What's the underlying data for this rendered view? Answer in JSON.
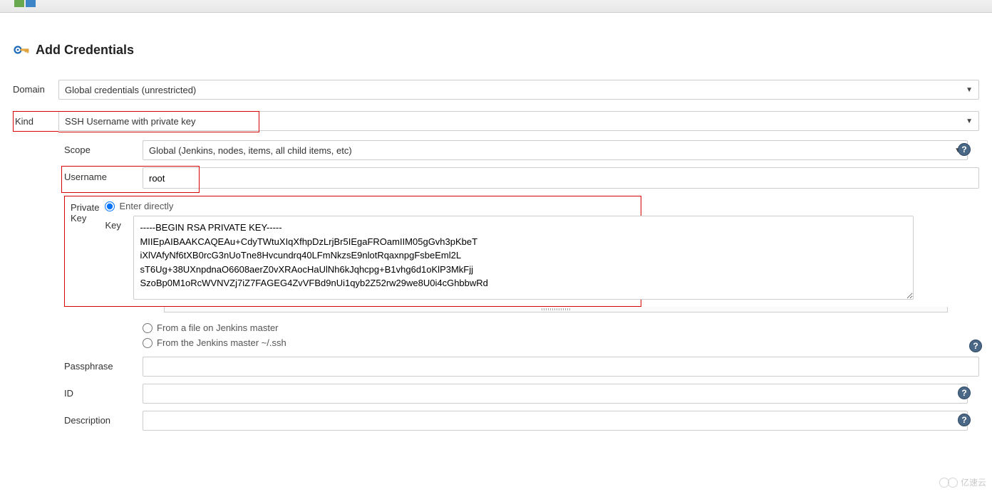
{
  "page": {
    "title": "Add Credentials"
  },
  "domain": {
    "label": "Domain",
    "value": "Global credentials (unrestricted)"
  },
  "kind": {
    "label": "Kind",
    "value": "SSH Username with private key"
  },
  "scope": {
    "label": "Scope",
    "value": "Global (Jenkins, nodes, items, all child items, etc)"
  },
  "username": {
    "label": "Username",
    "value": "root"
  },
  "private_key": {
    "label": "Private Key",
    "radio_enter_directly": "Enter directly",
    "radio_from_file": "From a file on Jenkins master",
    "radio_from_ssh": "From the Jenkins master ~/.ssh",
    "key_label": "Key",
    "key_value": "-----BEGIN RSA PRIVATE KEY-----\nMIIEpAIBAAKCAQEAu+CdyTWtuXIqXfhpDzLrjBr5IEgaFROamIIM05gGvh3pKbeT\niXlVAfyNf6tXB0rcG3nUoTne8Hvcundrq40LFmNkzsE9nlotRqaxnpgFsbeEml2L\nsT6Ug+38UXnpdnaO6608aerZ0vXRAocHaUlNh6kJqhcpg+B1vhg6d1oKlP3MkFjj\nSzoBp0M1oRcWVNVZj7iZ7FAGEG4ZvVFBd9nUi1qyb2Z52rw29we8U0i4cGhbbwRd"
  },
  "passphrase": {
    "label": "Passphrase",
    "value": ""
  },
  "id": {
    "label": "ID",
    "value": ""
  },
  "description": {
    "label": "Description",
    "value": ""
  },
  "watermark": "亿速云"
}
